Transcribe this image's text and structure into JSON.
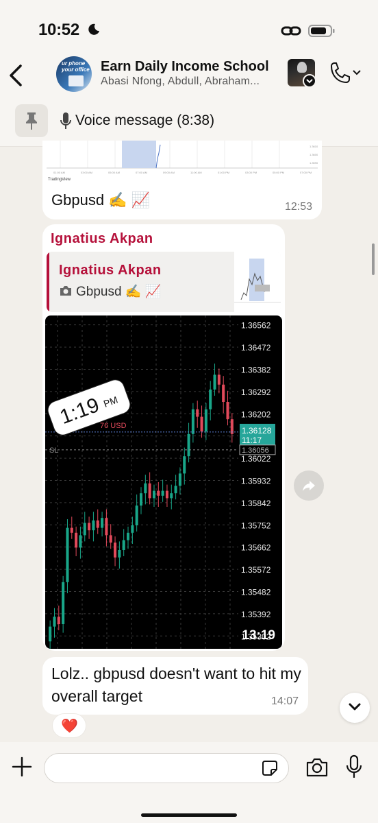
{
  "status_bar": {
    "time": "10:52"
  },
  "header": {
    "title": "Earn Daily Income School",
    "subtitle": "Abasi Nfong, Abdull, Abraham...",
    "avatar_caption": "ur phone your office"
  },
  "pinned": {
    "label": "Voice message (8:38)"
  },
  "messages": [
    {
      "text": "Gbpusd ✍️ 📈",
      "time": "12:53",
      "chart_watermark": "TradingView"
    },
    {
      "sender": "Ignatius Akpan",
      "quoted_sender": "Ignatius Akpan",
      "quoted_text": "Gbpusd ✍️ 📈",
      "overlay_time": "1:19",
      "overlay_ampm": "PM",
      "time": "13:19"
    },
    {
      "text": "Lolz.. gbpusd doesn't want to hit my overall target",
      "time": "14:07",
      "reaction": "❤️"
    }
  ],
  "chart_data": {
    "type": "candlestick",
    "price_axis_labels": [
      "1.36562",
      "1.36472",
      "1.36382",
      "1.36292",
      "1.36202",
      "1.36112",
      "1.36022",
      "1.35932",
      "1.35842",
      "1.35752",
      "1.35662",
      "1.35572",
      "1.35482",
      "1.35392",
      "1.35302"
    ],
    "current_price": "1.36128",
    "countdown": "11:17",
    "sl_price": "1.36056",
    "position_label": "76 USD",
    "sl_label": "SL",
    "ylim": [
      1.3525,
      1.366
    ],
    "closes": [
      1.3534,
      1.3538,
      1.3535,
      1.3552,
      1.3574,
      1.3572,
      1.3566,
      1.3571,
      1.3576,
      1.3573,
      1.3577,
      1.3574,
      1.3578,
      1.3571,
      1.3568,
      1.3562,
      1.3565,
      1.3569,
      1.3572,
      1.3575,
      1.3583,
      1.3588,
      1.3592,
      1.3586,
      1.3589,
      1.3587,
      1.3589,
      1.3586,
      1.3588,
      1.3591,
      1.3596,
      1.3603,
      1.3612,
      1.3622,
      1.3619,
      1.3613,
      1.3622,
      1.363,
      1.3636,
      1.3632,
      1.3625,
      1.3618,
      1.3612
    ],
    "colors": {
      "up": "#19a689",
      "down": "#e24a5b"
    }
  },
  "composer": {
    "placeholder": ""
  }
}
